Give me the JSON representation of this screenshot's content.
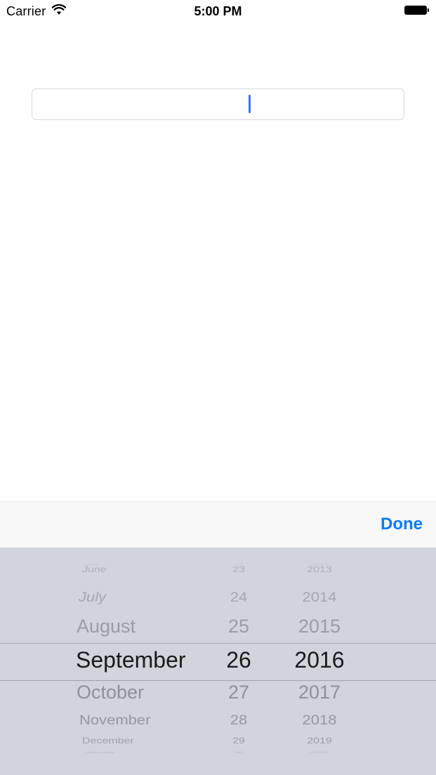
{
  "status_bar": {
    "carrier": "Carrier",
    "time": "5:00 PM",
    "wifi_icon": "wifi-icon",
    "battery_icon": "battery-icon"
  },
  "date_field": {
    "value": "",
    "placeholder": ""
  },
  "toolbar": {
    "done_label": "Done"
  },
  "picker": {
    "months": [
      "May",
      "June",
      "July",
      "August",
      "September",
      "October",
      "November",
      "December",
      "January"
    ],
    "days": [
      "22",
      "23",
      "24",
      "25",
      "26",
      "27",
      "28",
      "29",
      "30"
    ],
    "years": [
      "2012",
      "2013",
      "2014",
      "2015",
      "2016",
      "2017",
      "2018",
      "2019",
      "2020"
    ],
    "selected": {
      "month": "September",
      "day": "26",
      "year": "2016"
    }
  },
  "colors": {
    "accent": "#0a7aff",
    "cursor": "#3a76f0",
    "picker_background": "#d1d4db",
    "toolbar_background": "#f8f8f8"
  }
}
